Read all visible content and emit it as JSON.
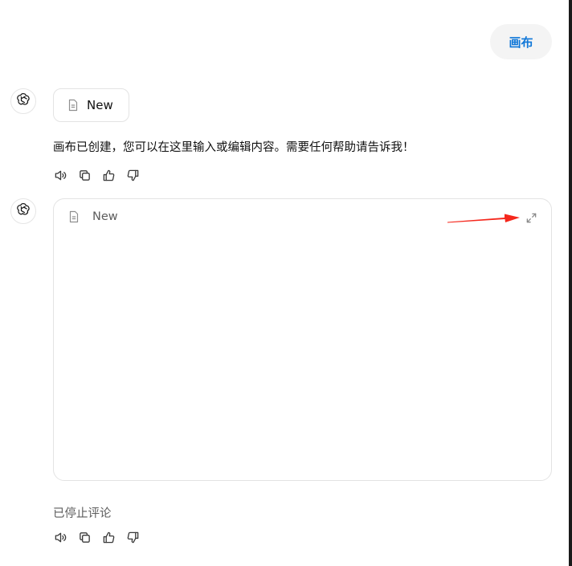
{
  "user_message": {
    "text": "画布",
    "color": "#0f77d8"
  },
  "assistant_avatar_icon": "openai-logo-icon",
  "canvas_chip": {
    "icon": "document-icon",
    "label": "New"
  },
  "assistant_message": {
    "text": "画布已创建，您可以在这里输入或编辑内容。需要任何帮助请告诉我！"
  },
  "message_actions": [
    {
      "icon": "speaker-icon"
    },
    {
      "icon": "copy-icon"
    },
    {
      "icon": "thumbs-up-icon"
    },
    {
      "icon": "thumbs-down-icon"
    }
  ],
  "canvas_panel": {
    "icon": "document-icon",
    "title": "New",
    "expand_icon": "expand-icon"
  },
  "annotation": {
    "color": "#f5271c"
  },
  "stopped": {
    "text": "已停止评论"
  }
}
